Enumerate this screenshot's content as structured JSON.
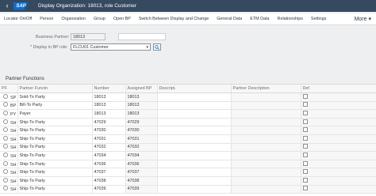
{
  "titlebar": {
    "back_glyph": "‹",
    "logo": "SAP",
    "title": "Display Organization: 18013, role Customer"
  },
  "toolbar": {
    "items": [
      "Locator On/Off",
      "Person",
      "Organization",
      "Group",
      "Open BP",
      "Switch Between Display and Change",
      "General Data",
      "ETM Data",
      "Relationships",
      "Settings"
    ],
    "more": "More ▾"
  },
  "form": {
    "bp_label": "Business Partner:",
    "bp_value": "18013",
    "role_label": "* Display in BP role:",
    "role_value": "FLCU01 Customer"
  },
  "section_title": "Partner Functions",
  "table": {
    "headers": [
      "PF",
      "Partner Functn",
      "Number",
      "Assigned BP",
      "Descript.",
      "Partner Description",
      "Def"
    ],
    "rows": [
      [
        "SP",
        "Sold-To Party",
        "18013",
        "18013"
      ],
      [
        "BP",
        "Bill-To Party",
        "18013",
        "18013"
      ],
      [
        "PY",
        "Payer",
        "18013",
        "18013"
      ],
      [
        "SH",
        "Ship-To Party",
        "47029",
        "47029"
      ],
      [
        "SH",
        "Ship-To Party",
        "47030",
        "47030"
      ],
      [
        "SH",
        "Ship-To Party",
        "47031",
        "47031"
      ],
      [
        "SH",
        "Ship-To Party",
        "47032",
        "47032"
      ],
      [
        "SH",
        "Ship-To Party",
        "47034",
        "47034"
      ],
      [
        "SH",
        "Ship-To Party",
        "47036",
        "47036"
      ],
      [
        "SH",
        "Ship-To Party",
        "47037",
        "47037"
      ],
      [
        "SH",
        "Ship-To Party",
        "47038",
        "47038"
      ],
      [
        "SH",
        "Ship-To Party",
        "47039",
        "47039"
      ]
    ]
  },
  "icons": {
    "search": "search-icon",
    "dropdown": "chevron-down-icon"
  }
}
